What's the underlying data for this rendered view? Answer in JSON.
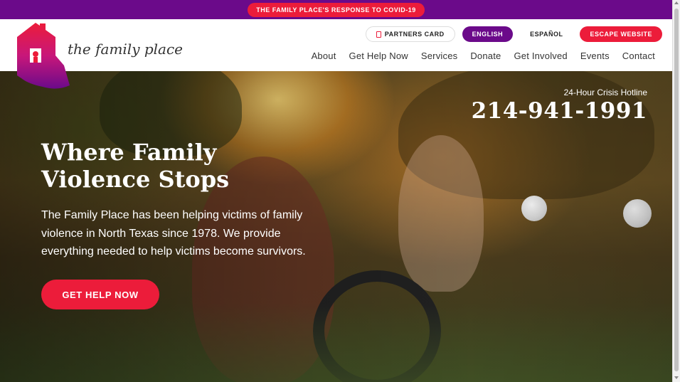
{
  "topbar": {
    "covid_label": "THE FAMILY PLACE'S RESPONSE TO COVID-19"
  },
  "brand": {
    "name": "the family place",
    "primary_color": "#6b0a8a",
    "accent_color": "#ec1c3a"
  },
  "utility": {
    "partners_label": "PARTNERS CARD",
    "english_label": "ENGLISH",
    "espanol_label": "ESPAÑOL",
    "escape_label": "ESCAPE WEBSITE"
  },
  "nav": {
    "items": [
      "About",
      "Get Help Now",
      "Services",
      "Donate",
      "Get Involved",
      "Events",
      "Contact"
    ]
  },
  "hero": {
    "title": "Where Family Violence Stops",
    "body": "The Family Place has been helping victims of family violence in North Texas since 1978. We provide everything needed to help victims become survivors.",
    "cta_label": "GET HELP NOW",
    "hotline_label": "24-Hour Crisis Hotline",
    "hotline_number": "214-941-1991"
  }
}
